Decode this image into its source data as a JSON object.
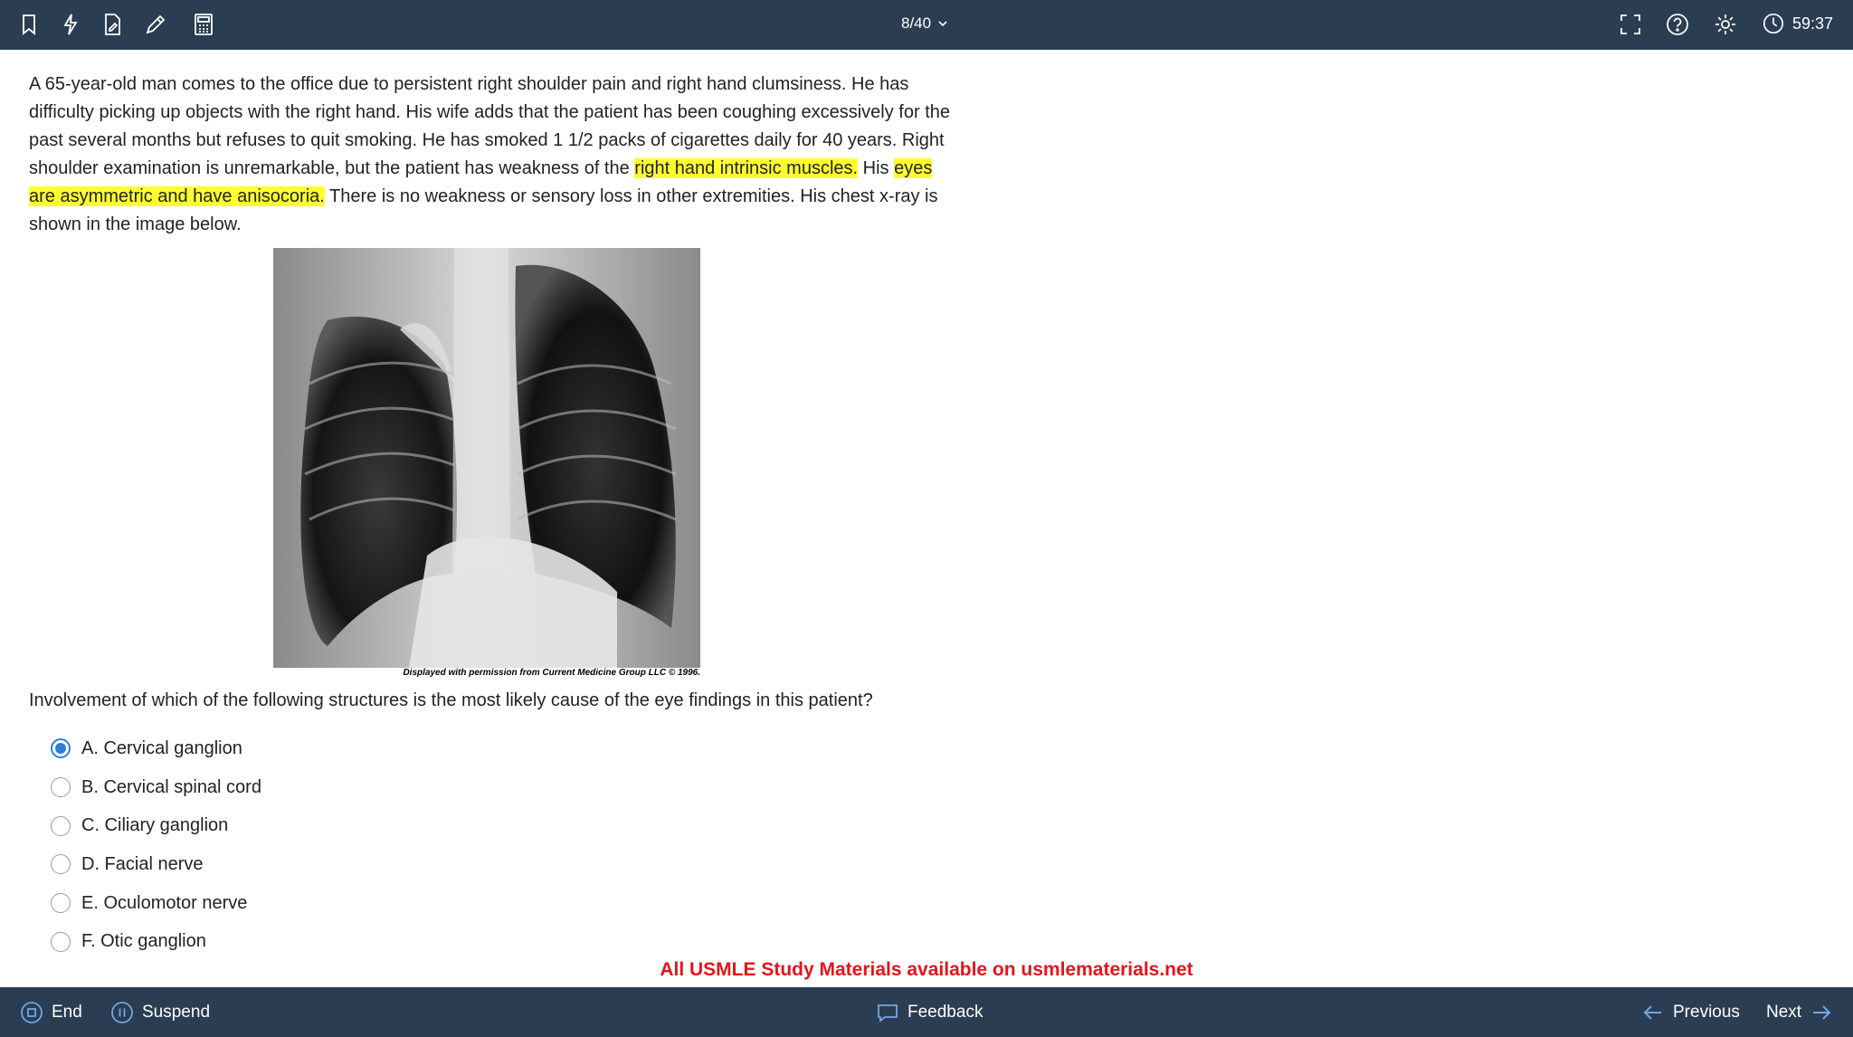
{
  "header": {
    "question_counter": "8/40",
    "timer": "59:37",
    "icons": [
      "bookmark-icon",
      "lightning-icon",
      "notes-icon",
      "pencil-icon",
      "calculator-icon",
      "fullscreen-icon",
      "help-icon",
      "gear-icon",
      "clock-icon"
    ]
  },
  "stem": {
    "part1": "A 65-year-old man comes to the office due to persistent right shoulder pain and right hand clumsiness.  He has difficulty picking up objects with the right hand.  His wife adds that the patient has been coughing excessively for the past several months but refuses to quit smoking.  He has smoked 1 1/2 packs of cigarettes daily for 40 years.  Right shoulder examination is unremarkable, but the patient has weakness of the ",
    "highlight1": "right hand intrinsic muscles.",
    "part2": "  His ",
    "highlight2": "eyes are asymmetric and have anisocoria.",
    "part3": "  There is no weakness or sensory loss in other extremities.  His chest x-ray is shown in the image below."
  },
  "image": {
    "caption": "Displayed with permission from Current Medicine Group LLC © 1996."
  },
  "question": "Involvement of which of the following structures is the most likely cause of the eye findings in this patient?",
  "choices": [
    {
      "label": "A. Cervical ganglion",
      "selected": true
    },
    {
      "label": "B. Cervical spinal cord",
      "selected": false
    },
    {
      "label": "C. Ciliary ganglion",
      "selected": false
    },
    {
      "label": "D. Facial nerve",
      "selected": false
    },
    {
      "label": "E. Oculomotor nerve",
      "selected": false
    },
    {
      "label": "F. Otic ganglion",
      "selected": false
    }
  ],
  "promo": "All USMLE Study Materials available on usmlematerials.net",
  "footer": {
    "end_label": "End",
    "suspend_label": "Suspend",
    "feedback_label": "Feedback",
    "previous_label": "Previous",
    "next_label": "Next"
  },
  "colors": {
    "bar": "#2b3d52",
    "highlight": "#ffff2e",
    "accent": "#2f7fd8",
    "promo": "#e2151b"
  }
}
